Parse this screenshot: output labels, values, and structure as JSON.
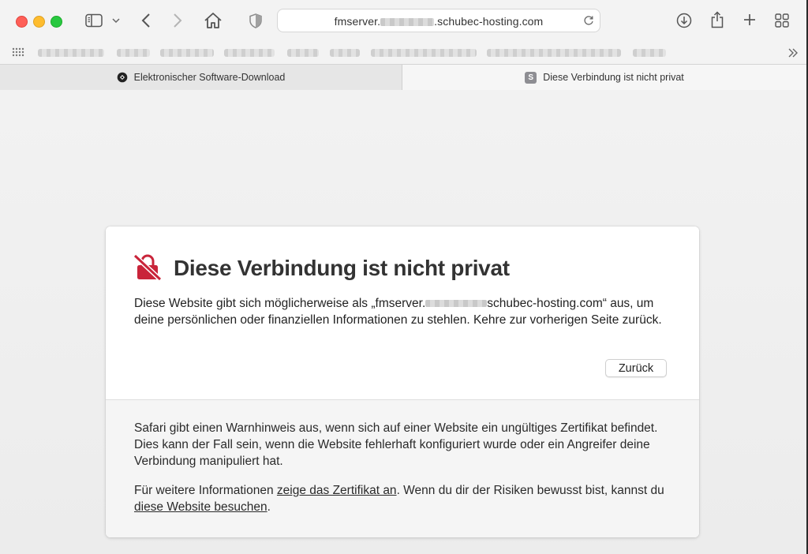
{
  "browser": {
    "url_prefix": "fmserver.",
    "url_suffix": ".schubec-hosting.com",
    "icons": {
      "sidebar": "sidebar-icon",
      "back": "chevron-left-icon",
      "forward": "chevron-right-icon",
      "home": "home-icon",
      "privacy": "shield-icon",
      "reload": "reload-icon",
      "download": "download-icon",
      "share": "share-icon",
      "new_tab": "plus-icon",
      "tab_overview": "grid-icon",
      "more": "double-chevron-right-icon"
    }
  },
  "tabs": [
    {
      "label": "Elektronischer Software-Download",
      "favicon": "logo-icon",
      "active": false
    },
    {
      "label": "Diese Verbindung ist nicht privat",
      "favicon": "S",
      "active": true
    }
  ],
  "warning": {
    "title": "Diese Verbindung ist nicht privat",
    "intro_part1": "Diese Website gibt sich möglicherweise als „fmserver.",
    "intro_part2": "schubec-hosting.com“ aus, um deine persönlichen oder finanziellen Informationen zu stehlen. Kehre zur vorherigen Seite zurück.",
    "back_button": "Zurück",
    "explanation": "Safari gibt einen Warnhinweis aus, wenn sich auf einer Website ein ungültiges Zertifikat befindet. Dies kann der Fall sein, wenn die Website fehlerhaft konfiguriert wurde oder ein Angreifer deine Verbindung manipuliert hat.",
    "more_info_part1": "Für weitere Informationen ",
    "show_certificate_link": "zeige das Zertifikat an",
    "more_info_part2": ". Wenn du dir der Risiken bewusst bist, kannst du ",
    "visit_website_link": "diese Website besuchen",
    "more_info_part3": ".",
    "accent_color": "#c9243a"
  }
}
